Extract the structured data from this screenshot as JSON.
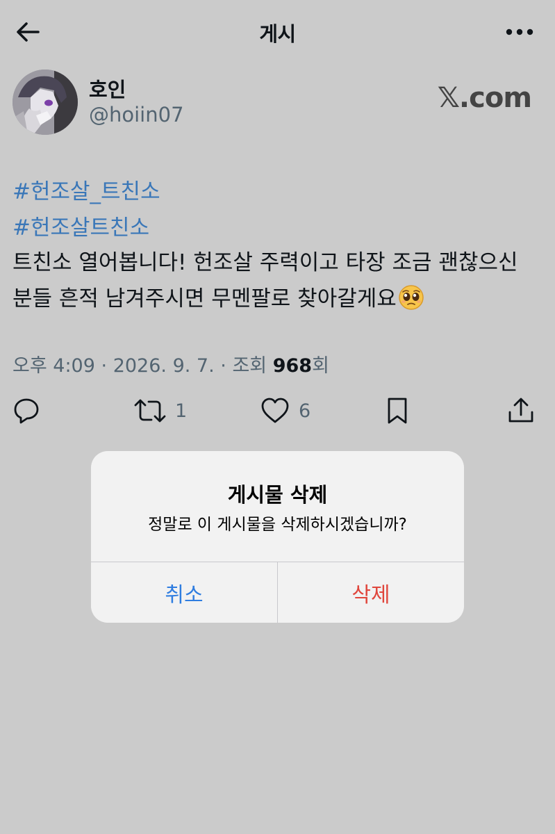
{
  "header": {
    "title": "게시",
    "back_icon": "arrow-left-icon",
    "more_icon": "more-dots-icon"
  },
  "author": {
    "display_name": "호인",
    "handle": "@hoiin07",
    "brand": "𝕏.com"
  },
  "post": {
    "hashtags": [
      "#헌조살_트친소",
      "#헌조살트친소"
    ],
    "text": "트친소 열어봅니다! 헌조살 주력이고 타장 조금 괜찮으신 분들 흔적 남겨주시면 무멘팔로 찾아갈게요",
    "emoji": "pleading-face-emoji"
  },
  "meta": {
    "time": "오후 4:09",
    "date": "2026. 9. 7.",
    "views_label": "조회",
    "views_count": "968",
    "views_suffix": "회",
    "separator": "·"
  },
  "actions": {
    "reply": {
      "icon": "reply-icon",
      "count": ""
    },
    "retweet": {
      "icon": "retweet-icon",
      "count": "1"
    },
    "like": {
      "icon": "heart-icon",
      "count": "6"
    },
    "bookmark": {
      "icon": "bookmark-icon"
    },
    "share": {
      "icon": "share-icon"
    }
  },
  "dialog": {
    "title": "게시물 삭제",
    "message": "정말로 이 게시물을 삭제하시겠습니까?",
    "cancel_label": "취소",
    "delete_label": "삭제"
  },
  "colors": {
    "background_dimmed": "#cbcbcb",
    "link": "#3a77b8",
    "cancel": "#2f7de0",
    "destructive": "#e0463c",
    "secondary_text": "#536471"
  }
}
